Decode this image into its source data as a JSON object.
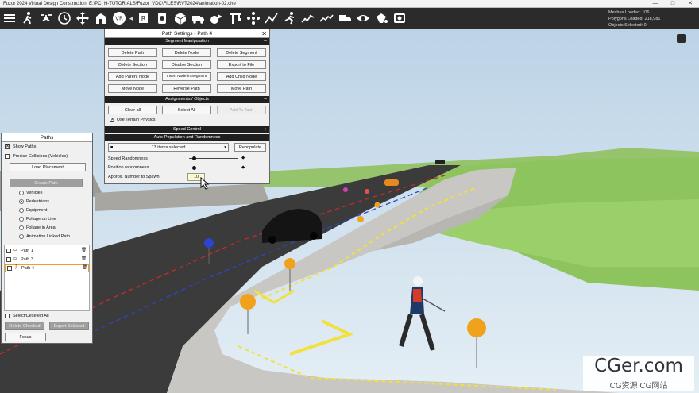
{
  "window": {
    "title": "Fuzor 2024 Virtual Design Construction: E:\\PC_H-TUTORIALS\\Fuzor_VDC\\FILES\\RVT2024\\animation-02.che",
    "controls": [
      "—",
      "□",
      "✕"
    ]
  },
  "toolbar": {
    "left_icons": [
      "menu-icon",
      "walk-icon",
      "drone-icon",
      "clock-icon",
      "move-icon",
      "building-icon",
      "vr-icon"
    ],
    "collapse": "◂",
    "right_icons": [
      "model-icon",
      "camera-icon",
      "cube-icon",
      "truck-icon",
      "animation-icon",
      "crane-icon",
      "people-icon",
      "path-icon",
      "runner-icon",
      "analytics-icon",
      "measure-icon",
      "transit-icon",
      "eye-icon",
      "bucket-icon",
      "screenshot-icon"
    ]
  },
  "stats": {
    "meshes": "Meshes Loaded: 106",
    "polygons": "Polygons Loaded: 218,981",
    "objects": "Objects Selected: 0"
  },
  "path_settings": {
    "title": "Path Settings - Path 4",
    "close": "✕",
    "section_segment": "Segment Manipulation",
    "buttons": [
      "Delete Path",
      "Delete Node",
      "Delete Segment",
      "Delete Section",
      "Disable Section",
      "Export to File",
      "Add Parent Node",
      "Insert Node in Segment",
      "Add Child Node",
      "Move Node",
      "Reverse Path",
      "Move Path"
    ],
    "section_assign": "Assignments / Objects",
    "clear_all": "Clear all",
    "select_all": "Select All",
    "add_to_task": "Add To Task",
    "use_terrain": "Use Terrain Physics",
    "section_speed": "Speed Control",
    "section_auto": "Auto-Population and Randomness",
    "items_selected": "13 items selected",
    "repopulate": "Repopulate",
    "speed_rand": "Speed Randomness",
    "position_rand": "Position randomness",
    "approx": "Approx. Number to Spawn",
    "spawn_value": "10",
    "speed_rand_level": 0.1,
    "position_rand_level": 0.1
  },
  "paths_panel": {
    "title": "Paths",
    "show_paths": "Show Paths",
    "precise_collisions": "Precise Collisions (Vehicles)",
    "load_placement": "Load Placement",
    "create_path": "Create Path",
    "types": [
      "Vehicles",
      "Pedestrians",
      "Equipment",
      "Foliage on Line",
      "Foliage in Area",
      "Animation Linked Path"
    ],
    "selected_type": "Pedestrians",
    "paths": [
      {
        "name": "Path 1"
      },
      {
        "name": "Path 3"
      },
      {
        "name": "Path 4"
      }
    ],
    "select_all": "Select/Deselect All",
    "delete_checked": "Delete Checked",
    "export_selected": "Export Selected",
    "focus": "Focus"
  },
  "watermark": {
    "big": "CGer.com",
    "small": "CG资源 CG网站"
  }
}
